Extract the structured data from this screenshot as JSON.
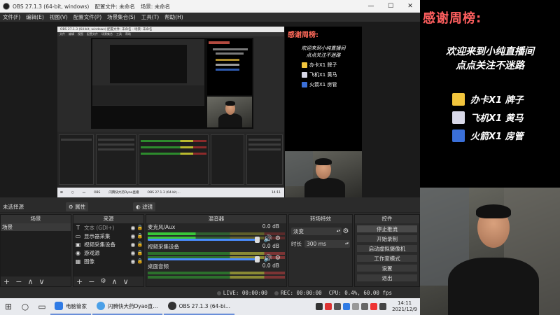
{
  "window": {
    "app_title": "OBS 27.1.3 (64-bit, windows)",
    "profile": "配置文件: 未命名",
    "scene_collection": "场景: 未命名",
    "controls": [
      "—",
      "☐",
      "✕"
    ]
  },
  "menu": [
    "文件(F)",
    "编辑(E)",
    "视图(V)",
    "配置文件(P)",
    "场景集合(S)",
    "工具(T)",
    "帮助(H)"
  ],
  "nested": {
    "title": "OBS 27.1.3 (64-bit, windows)    配置文件: 未命名 - 场景: 未命名",
    "menu": [
      "文件",
      "编辑",
      "视图",
      "配置文件",
      "场景集合",
      "工具",
      "帮助"
    ],
    "taskbar": [
      "⊞",
      "○",
      "▭",
      "OBS",
      "闪腾快大药Dyao直播",
      "OBS 27.1.3 (64-bit,...",
      "14:11"
    ]
  },
  "overlay": {
    "title": "感谢周榜:",
    "subtitle_line1": "欢迎来到小纯直播间",
    "subtitle_line2": "点点关注不迷路",
    "items": [
      {
        "label": "办卡X1 牌子",
        "color": "#f2c53d"
      },
      {
        "label": "飞机X1 黄马",
        "color": "#d8d8e8"
      },
      {
        "label": "火箭X1 房管",
        "color": "#3a6fd8"
      }
    ]
  },
  "noscene": {
    "label": "未选择源",
    "props_label": "属性",
    "filters_label": "滤镜"
  },
  "docks": {
    "scenes": {
      "title": "场景",
      "items": [
        "场景"
      ]
    },
    "sources": {
      "title": "来源",
      "items": [
        {
          "icon": "T",
          "label": "文本 (GDI+)",
          "name": "text-icon"
        },
        {
          "icon": "▭",
          "label": "显示器采集",
          "name": "monitor-icon"
        },
        {
          "icon": "▣",
          "label": "视频采集设备",
          "name": "camera-icon"
        },
        {
          "icon": "◉",
          "label": "游戏源",
          "name": "gamepad-icon"
        },
        {
          "icon": "▦",
          "label": "图像",
          "name": "image-icon"
        }
      ]
    },
    "mixer": {
      "title": "混音器",
      "tracks": [
        {
          "name": "麦克风/Aux",
          "db": "0.0 dB"
        },
        {
          "name": "视频采集设备",
          "db": "0.0 dB"
        },
        {
          "name": "桌面音频",
          "db": "0.0 dB"
        }
      ]
    },
    "transitions": {
      "title": "转场特效",
      "type": "淡变",
      "duration_label": "时长",
      "duration": "300 ms"
    },
    "controls": {
      "title": "控件",
      "buttons": [
        "停止推流",
        "开始录制",
        "启动虚拟摄像机",
        "工作室模式",
        "设置",
        "退出"
      ]
    }
  },
  "status": {
    "live": "LIVE: 00:00:00",
    "rec": "REC: 00:00:00",
    "cpu": "CPU: 0.4%, 60.00 fps"
  },
  "taskbar": {
    "apps": [
      {
        "label": "电脑管家",
        "color": "#2f7be5"
      },
      {
        "label": "闪腾快大药Dyao直...",
        "color": "#4aa0e8"
      },
      {
        "label": "OBS 27.1.3 (64-bi...",
        "color": "#333333"
      }
    ],
    "time": "14:11",
    "date": "2021/12/9"
  }
}
